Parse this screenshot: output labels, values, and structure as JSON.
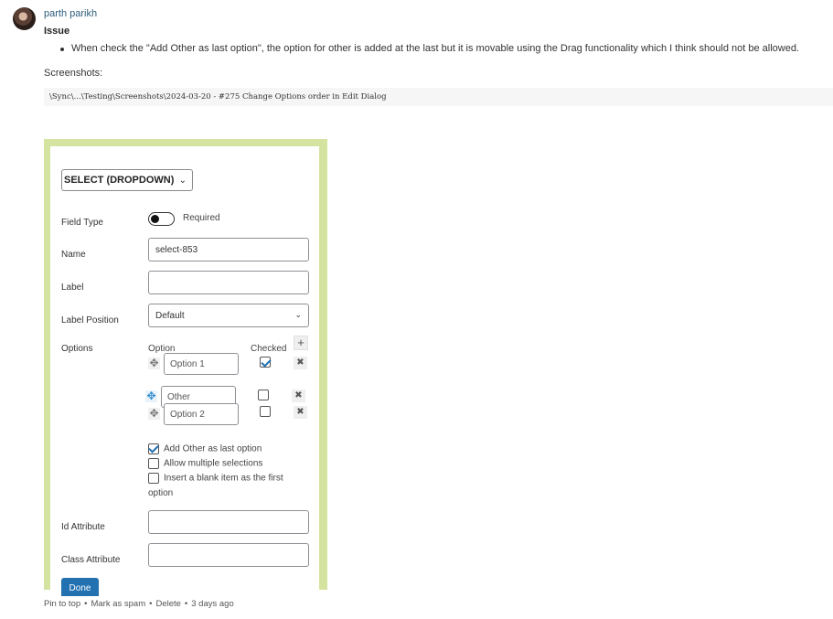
{
  "comment": {
    "author": "parth parikh",
    "heading": "Issue",
    "bullet": "When check the \"Add Other as last option\", the option for other is added at the last but it is movable using the Drag functionality which I think should not be allowed.",
    "screenshots_label": "Screenshots:",
    "path": "\\Sync\\...\\Testing\\Screenshots\\2024-03-20 - #275 Change Options order in Edit Dialog"
  },
  "dialog": {
    "field_type_select": "SELECT (DROPDOWN)",
    "field_type_label": "Field Type",
    "required_label": "Required",
    "name_label": "Name",
    "name_value": "select-853",
    "label_label": "Label",
    "label_value": "",
    "label_position_label": "Label Position",
    "label_position_value": "Default",
    "options_label": "Options",
    "option_col": "Option",
    "checked_col": "Checked",
    "options": [
      {
        "value": "Option 1",
        "checked": true
      },
      {
        "value": "Other",
        "checked": false
      },
      {
        "value": "Option 2",
        "checked": false
      }
    ],
    "add_other": "Add Other as last option",
    "allow_multiple": "Allow multiple selections",
    "insert_blank_1": "Insert a blank item as the first",
    "insert_blank_2": "option",
    "id_attr_label": "Id Attribute",
    "class_attr_label": "Class Attribute",
    "done": "Done"
  },
  "footer": {
    "pin": "Pin to top",
    "spam": "Mark as spam",
    "delete": "Delete",
    "time": "3 days ago",
    "sep": "•"
  },
  "icons": {
    "move": "move-arrows-icon",
    "close": "x-icon",
    "add": "plus-icon",
    "chevron": "chevron-down-icon"
  }
}
